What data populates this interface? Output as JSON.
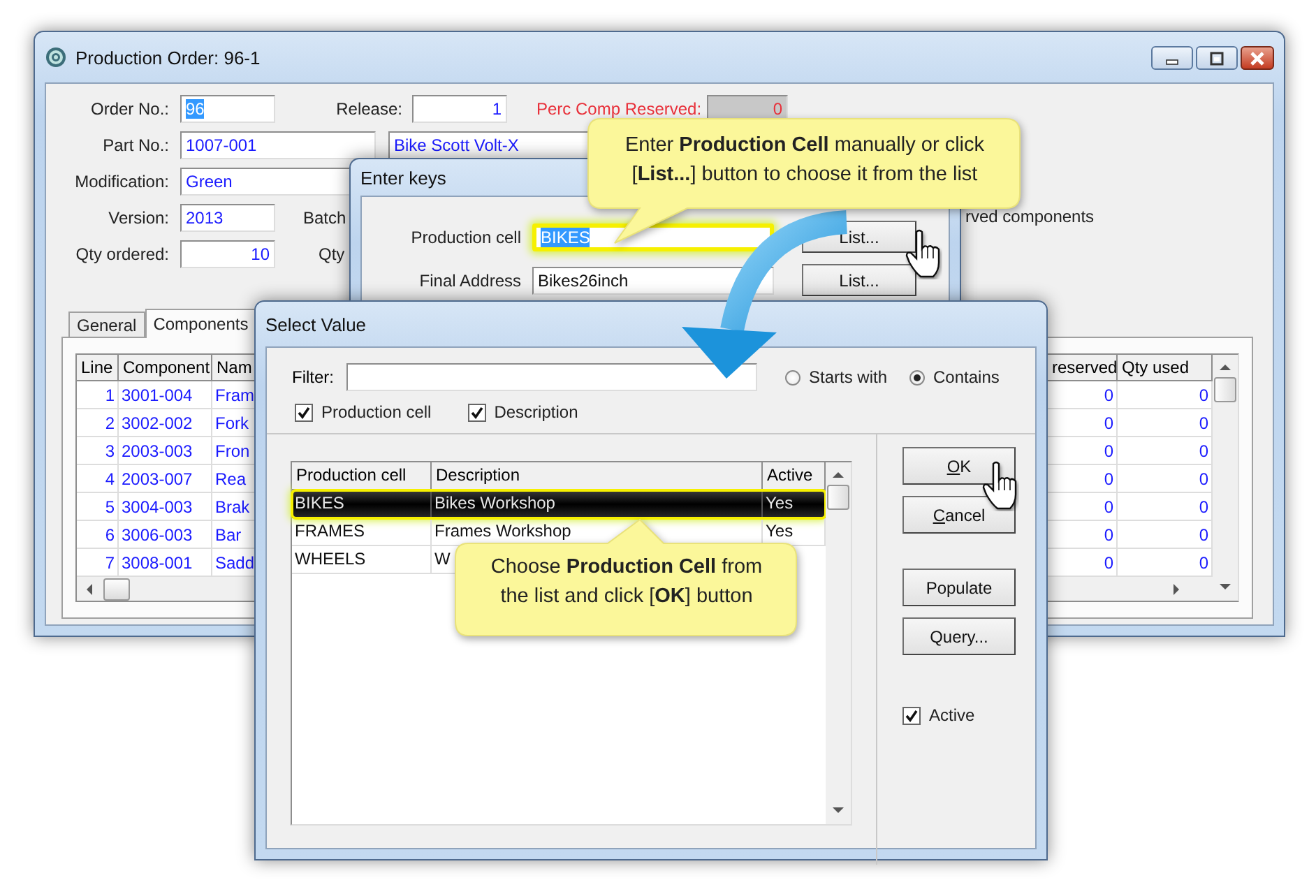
{
  "main_window": {
    "title": "Production Order: 96-1",
    "form_rows": [
      [
        {
          "kind": "label",
          "text": "Order No.:"
        },
        {
          "kind": "field_short",
          "value": "96",
          "selected": true
        },
        {
          "kind": "label",
          "text": "Release:"
        },
        {
          "kind": "field_number",
          "value": "1",
          "selected": false
        },
        {
          "kind": "warn_label",
          "text": "Perc Comp Reserved:"
        },
        {
          "kind": "field_readonly",
          "value": "0",
          "selected": false
        }
      ],
      [
        {
          "kind": "label",
          "text": "Part No.:"
        },
        {
          "kind": "field_long",
          "value": "1007-001",
          "selected": false
        },
        {
          "kind": "field_long",
          "value": "Bike Scott Volt-X",
          "selected": false
        }
      ],
      [
        {
          "kind": "label",
          "text": "Modification:"
        },
        {
          "kind": "field_long",
          "value": "Green",
          "selected": false
        }
      ],
      [
        {
          "kind": "label",
          "text": "Version:"
        },
        {
          "kind": "field_short",
          "value": "2013",
          "selected": false
        },
        {
          "kind": "label",
          "text": "Batch"
        }
      ],
      [
        {
          "kind": "label",
          "text": "Qty ordered:"
        },
        {
          "kind": "field_number",
          "value": "10",
          "selected": false
        },
        {
          "kind": "label",
          "text": "Qty"
        }
      ]
    ],
    "note": "rved components",
    "tabs": [
      {
        "label": "General",
        "selected": false
      },
      {
        "label": "Components",
        "selected": true
      }
    ],
    "table": {
      "columns": [
        "Line",
        "Component",
        "Nam",
        "reserved",
        "Qty used"
      ],
      "rows": [
        [
          "1",
          "3001-004",
          "Fram",
          "0",
          "0"
        ],
        [
          "2",
          "3002-002",
          "Fork",
          "0",
          "0"
        ],
        [
          "3",
          "2003-003",
          "Fron",
          "0",
          "0"
        ],
        [
          "4",
          "2003-007",
          "Rea",
          "0",
          "0"
        ],
        [
          "5",
          "3004-003",
          "Brak",
          "0",
          "0"
        ],
        [
          "6",
          "3006-003",
          "Bar",
          "0",
          "0"
        ],
        [
          "7",
          "3008-001",
          "Sadd",
          "0",
          "0"
        ]
      ]
    }
  },
  "enter_keys_dialog": {
    "title": "Enter keys",
    "rows": [
      {
        "label": "Production cell",
        "value": "BIKES",
        "selected": true,
        "highlighted": true,
        "button": "List..."
      },
      {
        "label": "Final Address",
        "value": "Bikes26inch",
        "selected": false,
        "highlighted": false,
        "button": "List..."
      }
    ]
  },
  "select_value_dialog": {
    "title": "Select Value",
    "filter_label": "Filter:",
    "match_options": [
      {
        "label": "Starts with",
        "selected": false
      },
      {
        "label": "Contains",
        "selected": true
      }
    ],
    "search_in": [
      {
        "label": "Production cell",
        "checked": true
      },
      {
        "label": "Description",
        "checked": true
      }
    ],
    "list": {
      "columns": [
        "Production cell",
        "Description",
        "Active"
      ],
      "rows": [
        {
          "cells": [
            "BIKES",
            "Bikes Workshop",
            "Yes"
          ],
          "selected": true,
          "highlighted": true
        },
        {
          "cells": [
            "FRAMES",
            "Frames Workshop",
            "Yes"
          ],
          "selected": false,
          "highlighted": false
        },
        {
          "cells": [
            "WHEELS",
            "W"
          ],
          "selected": false,
          "highlighted": false
        }
      ]
    },
    "buttons": [
      {
        "label": "OK",
        "accelerator": true
      },
      {
        "label": "Cancel",
        "accelerator": true
      },
      {
        "label": "Populate",
        "accelerator": false
      },
      {
        "label": "Query...",
        "accelerator": false
      }
    ],
    "active_checkbox": {
      "label": "Active",
      "checked": true
    }
  },
  "callouts": [
    {
      "text": "Enter **Production Cell** manually or click [**List...**] button to choose it from the list"
    },
    {
      "text": "Choose **Production Cell** from the list and click [**OK**] button"
    }
  ]
}
